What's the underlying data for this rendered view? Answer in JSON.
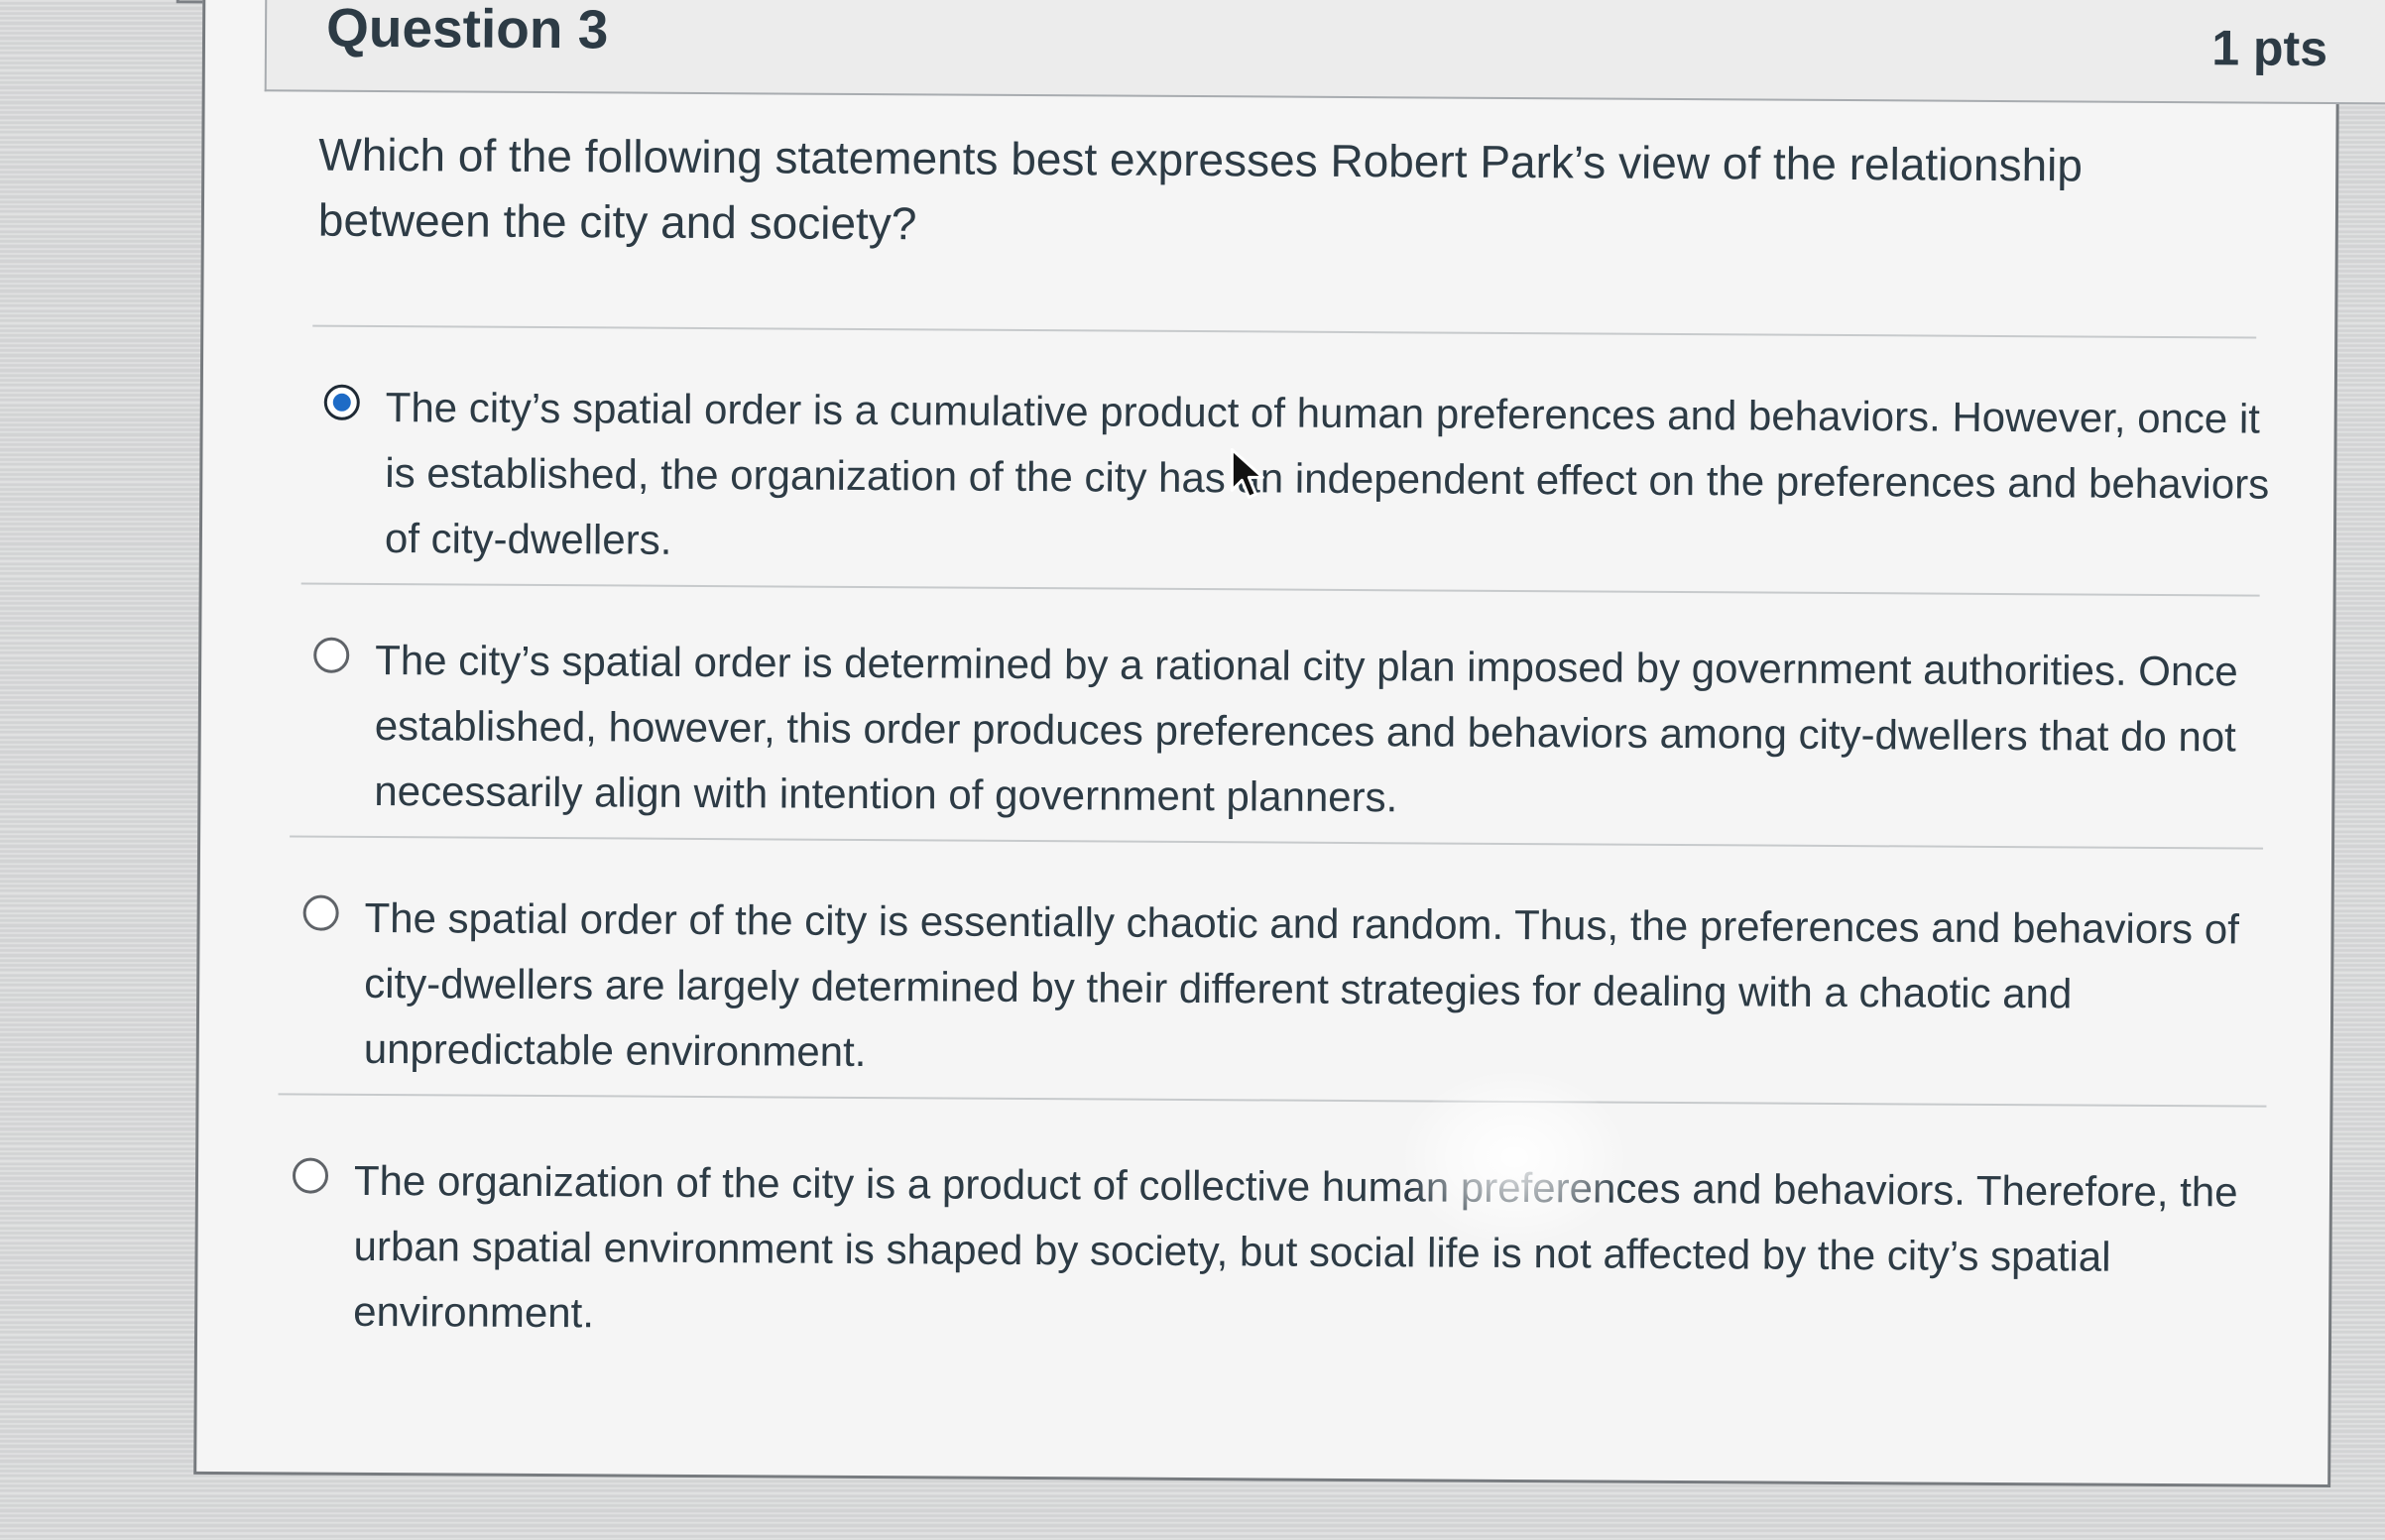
{
  "question": {
    "title": "Question 3",
    "points": "1 pts",
    "prompt": "Which of the following statements best expresses Robert Park’s view of the relationship between the city and society?",
    "answers": [
      {
        "label": "The city’s spatial order is a cumulative product of human preferences and behaviors. However, once it is established, the organization of the city has an independent effect on the preferences and behaviors of city-dwellers.",
        "selected": true
      },
      {
        "label": "The city’s spatial order is determined by a rational city plan imposed by government authorities. Once established, however, this order produces preferences and behaviors among city-dwellers that do not necessarily align with intention of government planners.",
        "selected": false
      },
      {
        "label": "The spatial order of the city is essentially chaotic and random. Thus, the preferences and behaviors of city-dwellers are largely determined by their different strategies for dealing with a chaotic and unpredictable environment.",
        "selected": false
      },
      {
        "label": "The organization of the city is a product of collective human preferences and behaviors. Therefore, the urban spatial environment is shaped by society, but social life is not affected by the city’s spatial environment.",
        "selected": false
      }
    ]
  },
  "colors": {
    "card_background": "#f5f5f5",
    "header_background": "#ececec",
    "text": "#2d3b45",
    "radio_selected": "#1e6bc6",
    "border": "#777b7f"
  },
  "icons": {
    "flag": "flag-icon",
    "cursor": "mouse-pointer-icon"
  }
}
